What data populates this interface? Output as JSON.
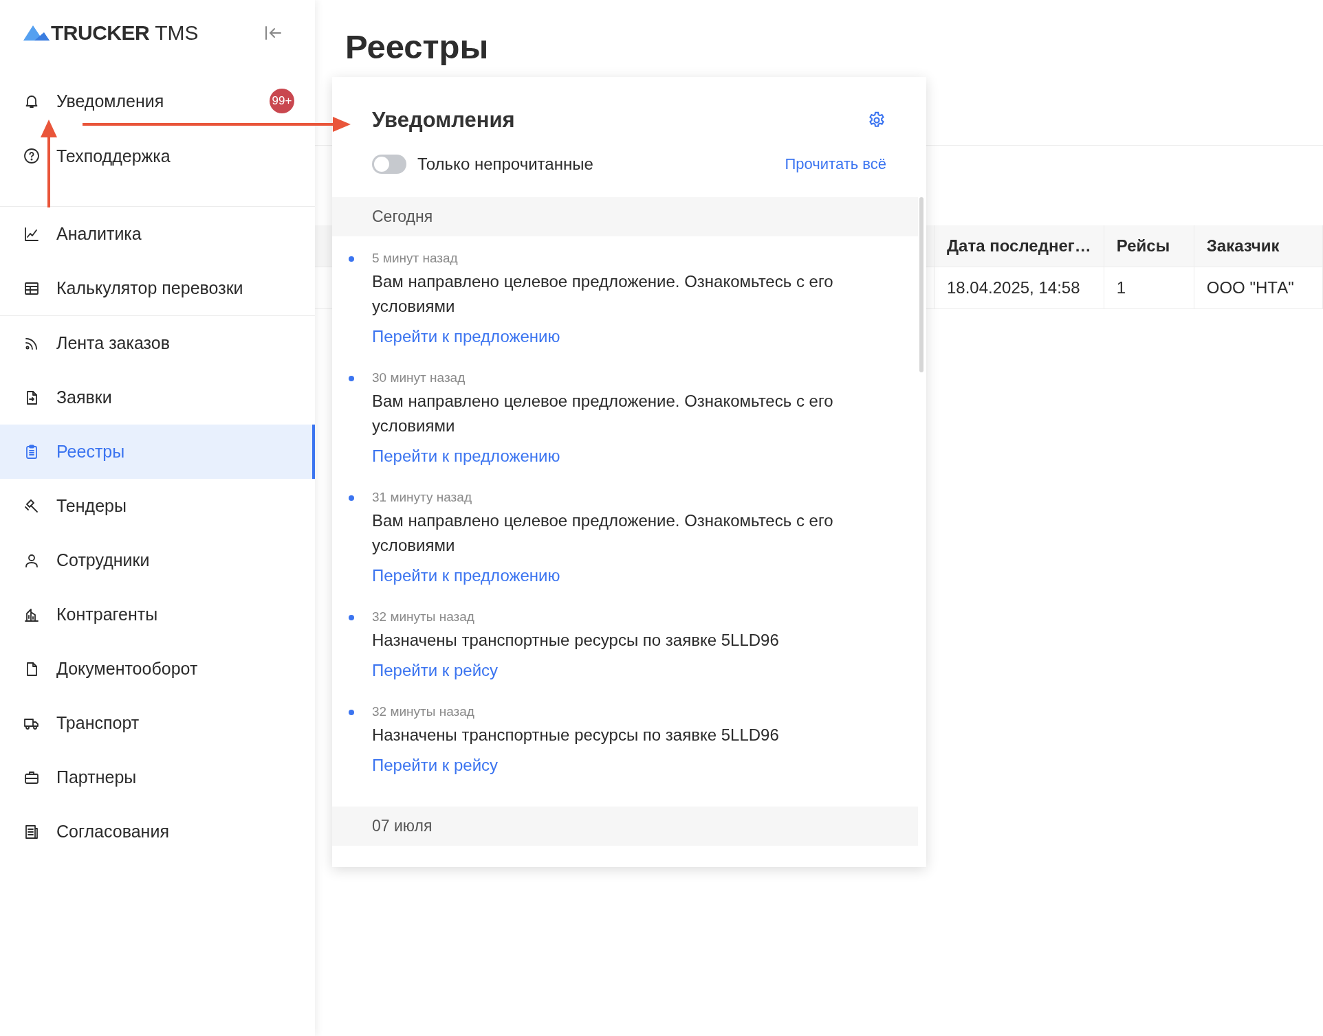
{
  "sidebar": {
    "logo": {
      "brand": "TRUCKER",
      "product": "TMS"
    },
    "top_items": [
      {
        "label": "Уведомления",
        "badge": "99+"
      },
      {
        "label": "Техподдержка"
      }
    ],
    "groups": [
      [
        {
          "label": "Аналитика",
          "selected": false
        },
        {
          "label": "Калькулятор перевозки",
          "selected": false
        }
      ],
      [
        {
          "label": "Лента заказов",
          "selected": false
        },
        {
          "label": "Заявки",
          "selected": false
        },
        {
          "label": "Реестры",
          "selected": true
        },
        {
          "label": "Тендеры",
          "selected": false
        },
        {
          "label": "Сотрудники",
          "selected": false
        },
        {
          "label": "Контрагенты",
          "selected": false
        },
        {
          "label": "Документооборот",
          "selected": false
        },
        {
          "label": "Транспорт",
          "selected": false
        },
        {
          "label": "Партнеры",
          "selected": false
        },
        {
          "label": "Согласования",
          "selected": false
        }
      ]
    ]
  },
  "page": {
    "title": "Реестры"
  },
  "table": {
    "columns": [
      "Дата последнег…",
      "Рейсы",
      "Заказчик"
    ],
    "rows": [
      {
        "cells": [
          "18.04.2025, 14:58",
          "1",
          "ООО \"НТА\""
        ]
      }
    ]
  },
  "notifications_panel": {
    "title": "Уведомления",
    "toggle": {
      "label": "Только непрочитанные",
      "on": false
    },
    "read_all": "Прочитать всё",
    "sections": [
      {
        "heading": "Сегодня",
        "items": [
          {
            "time": "5 минут назад",
            "text": "Вам направлено целевое предложение. Ознакомьтесь с его условиями",
            "link": "Перейти к предложению",
            "unread": true
          },
          {
            "time": "30 минут назад",
            "text": "Вам направлено целевое предложение. Ознакомьтесь с его условиями",
            "link": "Перейти к предложению",
            "unread": true
          },
          {
            "time": "31 минуту назад",
            "text": "Вам направлено целевое предложение. Ознакомьтесь с его условиями",
            "link": "Перейти к предложению",
            "unread": true
          },
          {
            "time": "32 минуты назад",
            "text": "Назначены транспортные ресурсы по заявке 5LLD96",
            "link": "Перейти к рейсу",
            "unread": true
          },
          {
            "time": "32 минуты назад",
            "text": "Назначены транспортные ресурсы по заявке 5LLD96",
            "link": "Перейти к рейсу",
            "unread": true
          }
        ]
      },
      {
        "heading": "07 июля"
      }
    ]
  }
}
